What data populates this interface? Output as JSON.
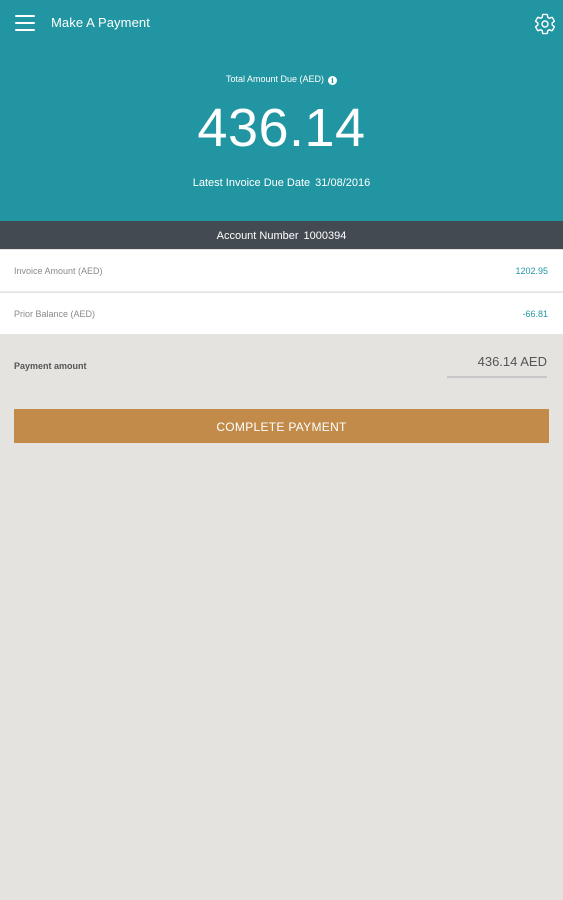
{
  "header": {
    "title": "Make A Payment",
    "menu_icon": "hamburger-menu-icon",
    "settings_icon": "gear-icon",
    "total_label": "Total Amount Due (AED)",
    "info_icon": "info-icon",
    "info_glyph": "i",
    "total_amount": "436.14",
    "due_date_label": "Latest Invoice Due Date",
    "due_date_value": "31/08/2016"
  },
  "account": {
    "label": "Account Number",
    "number": "1000394"
  },
  "details": [
    {
      "label": "Invoice Amount (AED)",
      "amount": "1202.95"
    },
    {
      "label": "Prior Balance (AED)",
      "amount": "-66.81"
    }
  ],
  "payment": {
    "label": "Payment amount",
    "value": "436.14 AED"
  },
  "actions": {
    "complete_label": "COMPLETE PAYMENT"
  },
  "colors": {
    "header_bg": "#2196a2",
    "account_bar_bg": "#434a52",
    "button_bg": "#c28b4a",
    "page_bg": "#e4e3e0",
    "amount_text": "#2196a2"
  }
}
